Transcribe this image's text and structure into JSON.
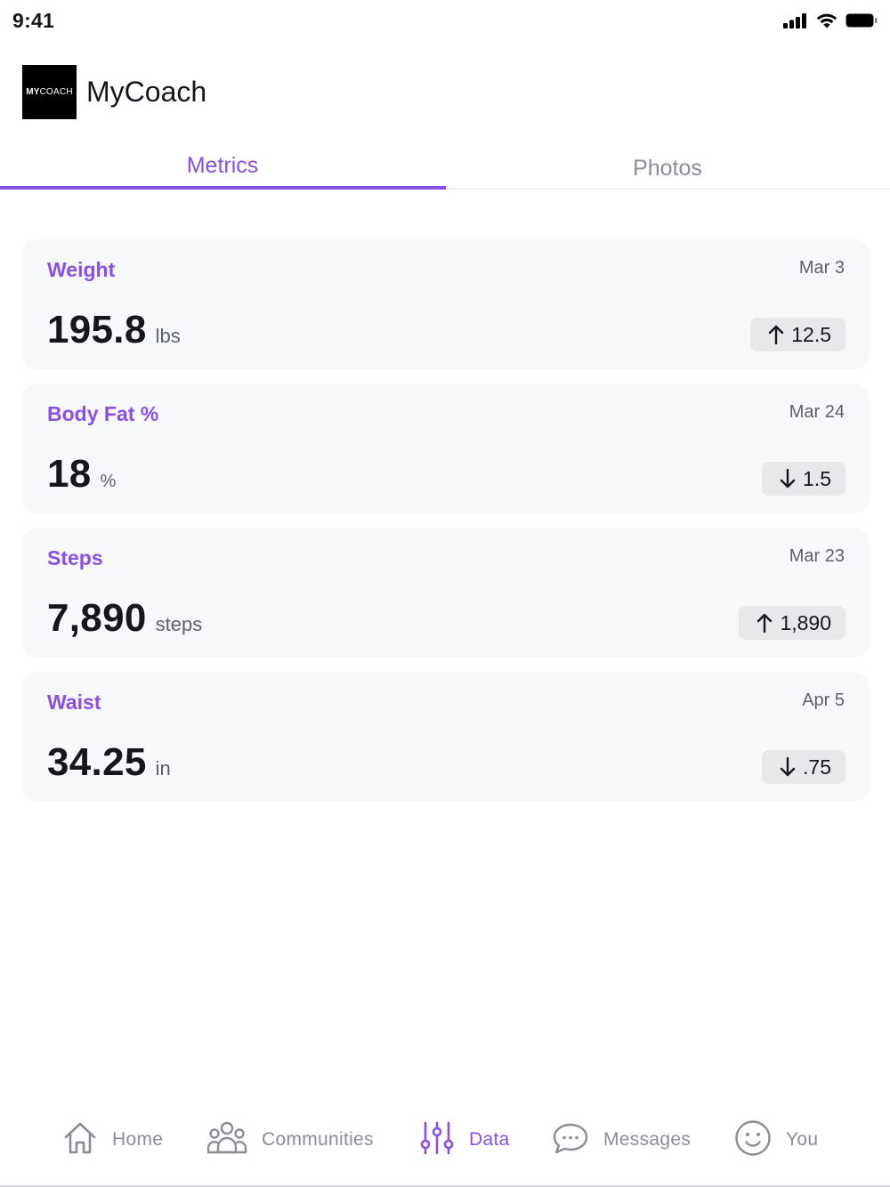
{
  "status_bar": {
    "time": "9:41"
  },
  "app": {
    "title": "MyCoach",
    "logo_bold": "MY",
    "logo_light": "COACH"
  },
  "tabs": [
    {
      "label": "Metrics",
      "active": true
    },
    {
      "label": "Photos",
      "active": false
    }
  ],
  "metrics": [
    {
      "name": "Weight",
      "date": "Mar 3",
      "value": "195.8",
      "unit": "lbs",
      "change": "12.5",
      "direction": "up"
    },
    {
      "name": "Body Fat %",
      "date": "Mar 24",
      "value": "18",
      "unit": "%",
      "change": "1.5",
      "direction": "down"
    },
    {
      "name": "Steps",
      "date": "Mar 23",
      "value": "7,890",
      "unit": "steps",
      "change": "1,890",
      "direction": "up"
    },
    {
      "name": "Waist",
      "date": "Apr 5",
      "value": "34.25",
      "unit": "in",
      "change": ".75",
      "direction": "down"
    }
  ],
  "nav": [
    {
      "label": "Home",
      "icon": "home-icon",
      "active": false
    },
    {
      "label": "Communities",
      "icon": "people-icon",
      "active": false
    },
    {
      "label": "Data",
      "icon": "sliders-icon",
      "active": true
    },
    {
      "label": "Messages",
      "icon": "chat-bubble-icon",
      "active": false
    },
    {
      "label": "You",
      "icon": "smiley-icon",
      "active": false
    }
  ],
  "colors": {
    "accent": "#8a4fe6",
    "text": "#16171d",
    "muted": "#8a8d96",
    "card": "#f7f8fa",
    "badge": "#e7e8ea"
  }
}
